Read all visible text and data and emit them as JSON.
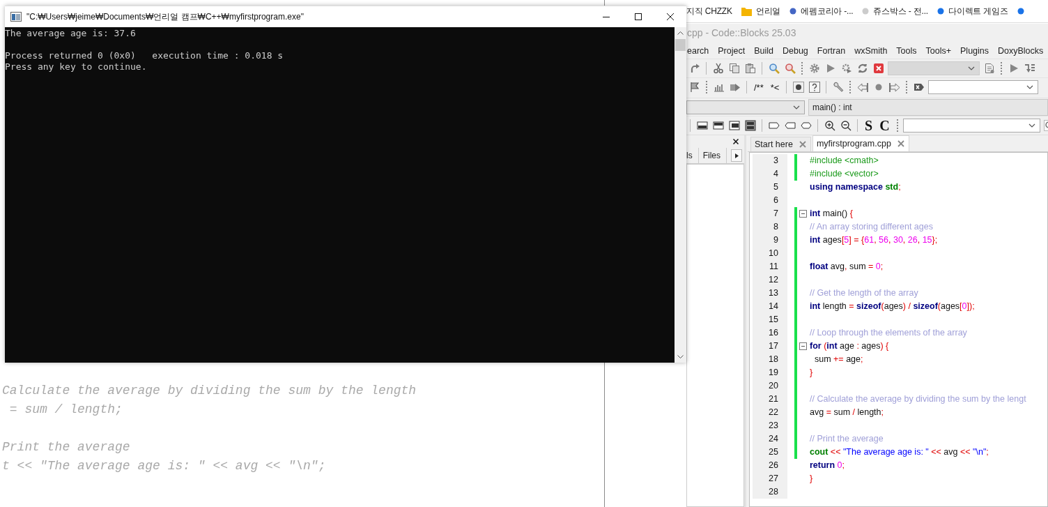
{
  "background_editor": {
    "paragraphs": [
      [
        "Calculate the average by dividing the sum by the length",
        " = sum / length;"
      ],
      [
        "Print the average",
        "t << \"The average age is: \" << avg << \"\\n\";"
      ]
    ]
  },
  "console": {
    "title": "\"C:₩Users₩jeime₩Documents₩언리얼 캠프₩C++₩myfirstprogram.exe\"",
    "output": [
      [
        "The average age is: 37.6"
      ],
      [
        "Process returned 0 (0x0)   execution time : 0.018 s",
        "Press any key to continue."
      ]
    ]
  },
  "bookmarks": [
    {
      "label": "지직 CHZZK",
      "kind": "site"
    },
    {
      "label": "언리얼",
      "kind": "folder"
    },
    {
      "label": "에펨코리아 -...",
      "kind": "site",
      "color": "#4466c4"
    },
    {
      "label": "쥬스박스 - 전...",
      "kind": "site",
      "color": "#cccccc"
    },
    {
      "label": "다이렉트 게임즈",
      "kind": "site",
      "color": "#1a73e8"
    },
    {
      "kind": "site",
      "color": "#1a73e8"
    }
  ],
  "ide": {
    "title": "cpp - Code::Blocks 25.03",
    "menu": [
      "earch",
      "Project",
      "Build",
      "Debug",
      "Fortran",
      "wxSmith",
      "Tools",
      "Tools+",
      "Plugins",
      "DoxyBlocks"
    ],
    "build_target": {
      "disabled": true
    },
    "comment_buttons": [
      "/**",
      "*<"
    ],
    "function_selector": "main() : int",
    "style_buttons": [
      "S",
      "C"
    ],
    "panel_tabs": [
      "ls",
      "Files"
    ],
    "editor_tabs": [
      {
        "label": "Start here",
        "selected": false
      },
      {
        "label": "myfirstprogram.cpp",
        "selected": true
      }
    ],
    "lines": [
      {
        "number": "3",
        "changed": true,
        "fold": false,
        "tokens": [
          {
            "kind": "pp",
            "text": "#include <cmath>"
          }
        ]
      },
      {
        "number": "4",
        "changed": true,
        "fold": false,
        "tokens": [
          {
            "kind": "pp",
            "text": "#include <vector>"
          }
        ]
      },
      {
        "number": "5",
        "changed": false,
        "fold": false,
        "tokens": [
          {
            "kind": "kw",
            "text": "using namespace "
          },
          {
            "kind": "lib",
            "text": "std"
          },
          {
            "kind": "op",
            "text": ";"
          }
        ]
      },
      {
        "number": "6",
        "changed": false,
        "fold": false
      },
      {
        "number": "7",
        "changed": true,
        "fold": true,
        "tokens": [
          {
            "kind": "kw",
            "text": "int"
          },
          {
            "kind": "plain",
            "text": " main() "
          },
          {
            "kind": "op",
            "text": "{"
          }
        ]
      },
      {
        "number": "8",
        "changed": true,
        "fold": false,
        "tokens": [
          {
            "kind": "cm",
            "text": "// An array storing different ages"
          }
        ]
      },
      {
        "number": "9",
        "changed": true,
        "fold": false,
        "tokens": [
          {
            "kind": "kw",
            "text": "int"
          },
          {
            "kind": "plain",
            "text": " ages"
          },
          {
            "kind": "op",
            "text": "["
          },
          {
            "kind": "num",
            "text": "5"
          },
          {
            "kind": "op",
            "text": "] = {"
          },
          {
            "kind": "num",
            "text": "61"
          },
          {
            "kind": "op",
            "text": ", "
          },
          {
            "kind": "num",
            "text": "56"
          },
          {
            "kind": "op",
            "text": ", "
          },
          {
            "kind": "num",
            "text": "30"
          },
          {
            "kind": "op",
            "text": ", "
          },
          {
            "kind": "num",
            "text": "26"
          },
          {
            "kind": "op",
            "text": ", "
          },
          {
            "kind": "num",
            "text": "15"
          },
          {
            "kind": "op",
            "text": "};"
          }
        ]
      },
      {
        "number": "10",
        "changed": true,
        "fold": false
      },
      {
        "number": "11",
        "changed": true,
        "fold": false,
        "tokens": [
          {
            "kind": "kw",
            "text": "float"
          },
          {
            "kind": "plain",
            "text": " avg"
          },
          {
            "kind": "op",
            "text": ","
          },
          {
            "kind": "plain",
            "text": " sum "
          },
          {
            "kind": "op",
            "text": "= "
          },
          {
            "kind": "num",
            "text": "0"
          },
          {
            "kind": "op",
            "text": ";"
          }
        ]
      },
      {
        "number": "12",
        "changed": true,
        "fold": false
      },
      {
        "number": "13",
        "changed": true,
        "fold": false,
        "tokens": [
          {
            "kind": "cm",
            "text": "// Get the length of the array"
          }
        ]
      },
      {
        "number": "14",
        "changed": true,
        "fold": false,
        "tokens": [
          {
            "kind": "kw",
            "text": "int"
          },
          {
            "kind": "plain",
            "text": " length "
          },
          {
            "kind": "op",
            "text": "= "
          },
          {
            "kind": "kw",
            "text": "sizeof"
          },
          {
            "kind": "op",
            "text": "("
          },
          {
            "kind": "plain",
            "text": "ages"
          },
          {
            "kind": "op",
            "text": ") / "
          },
          {
            "kind": "kw",
            "text": "sizeof"
          },
          {
            "kind": "op",
            "text": "("
          },
          {
            "kind": "plain",
            "text": "ages"
          },
          {
            "kind": "op",
            "text": "["
          },
          {
            "kind": "num",
            "text": "0"
          },
          {
            "kind": "op",
            "text": "]);"
          }
        ]
      },
      {
        "number": "15",
        "changed": true,
        "fold": false
      },
      {
        "number": "16",
        "changed": true,
        "fold": false,
        "tokens": [
          {
            "kind": "cm",
            "text": "// Loop through the elements of the array"
          }
        ]
      },
      {
        "number": "17",
        "changed": true,
        "fold": true,
        "tokens": [
          {
            "kind": "kw",
            "text": "for"
          },
          {
            "kind": "op",
            "text": " ("
          },
          {
            "kind": "kw",
            "text": "int"
          },
          {
            "kind": "plain",
            "text": " age "
          },
          {
            "kind": "op",
            "text": ":"
          },
          {
            "kind": "plain",
            "text": " ages"
          },
          {
            "kind": "op",
            "text": ") {"
          }
        ]
      },
      {
        "number": "18",
        "changed": true,
        "fold": false,
        "tokens": [
          {
            "kind": "plain",
            "text": "  sum "
          },
          {
            "kind": "op",
            "text": "+="
          },
          {
            "kind": "plain",
            "text": " age"
          },
          {
            "kind": "op",
            "text": ";"
          }
        ]
      },
      {
        "number": "19",
        "changed": true,
        "fold": false,
        "tokens": [
          {
            "kind": "op",
            "text": "}"
          }
        ]
      },
      {
        "number": "20",
        "changed": true,
        "fold": false
      },
      {
        "number": "21",
        "changed": true,
        "fold": false,
        "tokens": [
          {
            "kind": "cm",
            "text": "// Calculate the average by dividing the sum by the lengt"
          }
        ]
      },
      {
        "number": "22",
        "changed": true,
        "fold": false,
        "tokens": [
          {
            "kind": "plain",
            "text": "avg "
          },
          {
            "kind": "op",
            "text": "="
          },
          {
            "kind": "plain",
            "text": " sum "
          },
          {
            "kind": "op",
            "text": "/"
          },
          {
            "kind": "plain",
            "text": " length"
          },
          {
            "kind": "op",
            "text": ";"
          }
        ]
      },
      {
        "number": "23",
        "changed": true,
        "fold": false
      },
      {
        "number": "24",
        "changed": true,
        "fold": false,
        "tokens": [
          {
            "kind": "cm",
            "text": "// Print the average"
          }
        ]
      },
      {
        "number": "25",
        "changed": true,
        "fold": false,
        "tokens": [
          {
            "kind": "lib",
            "text": "cout"
          },
          {
            "kind": "op",
            "text": " << "
          },
          {
            "kind": "str",
            "text": "\"The average age is: \""
          },
          {
            "kind": "op",
            "text": " << "
          },
          {
            "kind": "plain",
            "text": "avg "
          },
          {
            "kind": "op",
            "text": "<< "
          },
          {
            "kind": "str",
            "text": "\"\\n\""
          },
          {
            "kind": "op",
            "text": ";"
          }
        ]
      },
      {
        "number": "26",
        "changed": false,
        "fold": false,
        "tokens": [
          {
            "kind": "kw",
            "text": "return "
          },
          {
            "kind": "num",
            "text": "0"
          },
          {
            "kind": "op",
            "text": ";"
          }
        ]
      },
      {
        "number": "27",
        "changed": false,
        "fold": false,
        "tokens": [
          {
            "kind": "op",
            "text": "}"
          }
        ]
      },
      {
        "number": "28",
        "changed": false,
        "fold": false
      }
    ]
  }
}
